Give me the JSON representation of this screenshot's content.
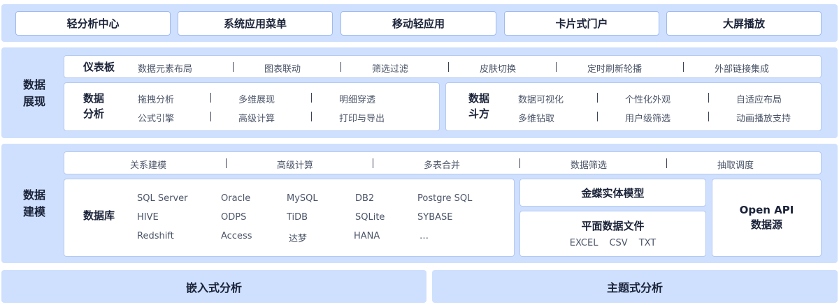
{
  "top_menu": [
    "轻分析中心",
    "系统应用菜单",
    "移动轻应用",
    "卡片式门户",
    "大屏播放"
  ],
  "display": {
    "section_title": "数据\n展现",
    "dashboard": {
      "title": "仪表板",
      "items": [
        "数据元素布局",
        "图表联动",
        "筛选过滤",
        "皮肤切换",
        "定时刷新轮播",
        "外部链接集成"
      ]
    },
    "analysis": {
      "title": "数据\n分析",
      "row1": [
        "拖拽分析",
        "多维展现",
        "明细穿透"
      ],
      "row2": [
        "公式引擎",
        "高级计算",
        "打印与导出"
      ]
    },
    "doufang": {
      "title": "数据\n斗方",
      "row1": [
        "数据可视化",
        "个性化外观",
        "自适应布局"
      ],
      "row2": [
        "多维钻取",
        "用户级筛选",
        "动画播放支持"
      ]
    }
  },
  "modeling": {
    "section_title": "数据\n建模",
    "features": [
      "关系建模",
      "高级计算",
      "多表合并",
      "数据筛选",
      "抽取调度"
    ],
    "database": {
      "title": "数据库",
      "rows": [
        [
          "SQL Server",
          "Oracle",
          "MySQL",
          "DB2",
          "Postgre SQL"
        ],
        [
          "HIVE",
          "ODPS",
          "TiDB",
          "SQLite",
          "SYBASE"
        ],
        [
          "Redshift",
          "Access",
          "达梦",
          "HANA",
          "…"
        ]
      ]
    },
    "entity_model": "金蝶实体模型",
    "flat_file": {
      "title": "平面数据文件",
      "formats": [
        "EXCEL",
        "CSV",
        "TXT"
      ]
    },
    "open_api": "Open API\n数据源"
  },
  "bottom": [
    "嵌入式分析",
    "主题式分析"
  ]
}
